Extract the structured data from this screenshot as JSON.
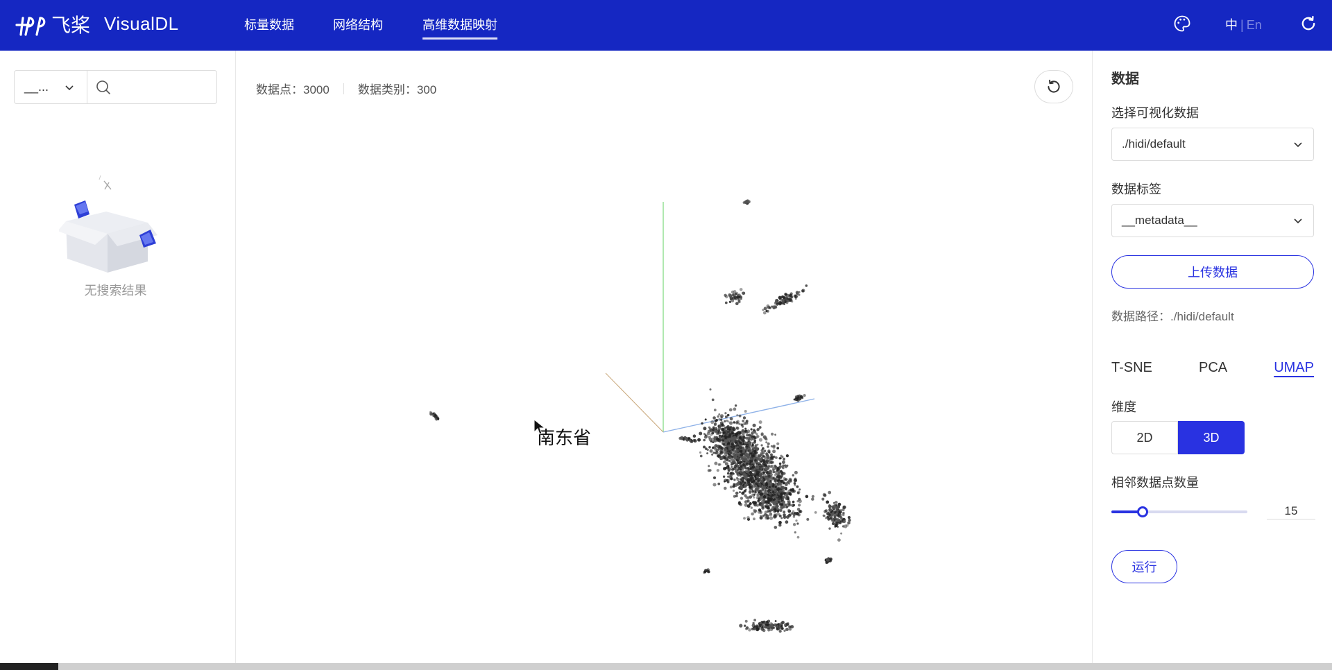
{
  "app": {
    "logo_text": "VisualDL",
    "brand_cn": "飞桨",
    "colors": {
      "header": "#1527c2",
      "accent": "#2932e1"
    }
  },
  "nav": {
    "items": [
      {
        "label": "标量数据"
      },
      {
        "label": "网络结构"
      },
      {
        "label": "高维数据映射",
        "active": true
      }
    ]
  },
  "header_right": {
    "lang_zh": "中",
    "lang_sep": "|",
    "lang_en": "En",
    "icons": [
      "palette-icon",
      "refresh-icon"
    ]
  },
  "left_panel": {
    "search_select_value": "__...",
    "search_placeholder": "",
    "empty_text": "无搜索结果"
  },
  "center": {
    "stats": {
      "points_label": "数据点：3000",
      "categories_label": "数据类别：300"
    },
    "hover_label": "南东省"
  },
  "right_panel": {
    "section_title": "数据",
    "vis_data_label": "选择可视化数据",
    "vis_data_value": "./hidi/default",
    "label_label": "数据标签",
    "label_value": "__metadata__",
    "upload_label": "上传数据",
    "path_text": "数据路径：./hidi/default",
    "algorithms": [
      "T-SNE",
      "PCA",
      "UMAP"
    ],
    "active_algorithm": "UMAP",
    "dimension_label": "维度",
    "dim_2d": "2D",
    "dim_3d": "3D",
    "active_dimension": "3D",
    "neighbors_label": "相邻数据点数量",
    "neighbors_value": "15",
    "neighbors_level": 0.23,
    "run_label": "运行"
  }
}
